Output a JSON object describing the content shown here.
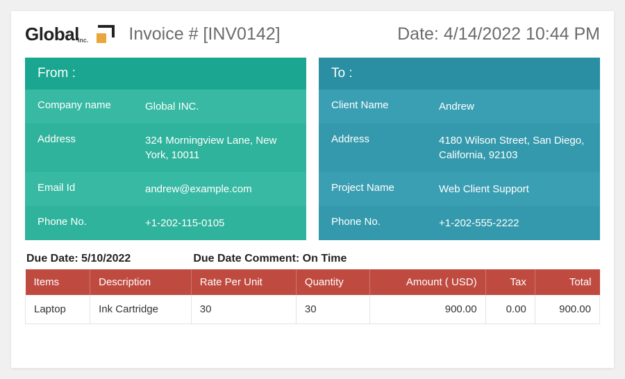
{
  "header": {
    "logo_main": "Global",
    "logo_sub": "Inc.",
    "invoice_number_label": "Invoice # [INV0142]",
    "date_label": "Date: 4/14/2022 10:44 PM"
  },
  "from": {
    "title": "From :",
    "fields": {
      "company_label": "Company name",
      "company_value": "Global INC.",
      "address_label": "Address",
      "address_value": "324 Morningview Lane, New York, 10011",
      "email_label": "Email Id",
      "email_value": "andrew@example.com",
      "phone_label": "Phone No.",
      "phone_value": "+1-202-115-0105"
    }
  },
  "to": {
    "title": "To :",
    "fields": {
      "client_label": "Client Name",
      "client_value": "Andrew",
      "address_label": "Address",
      "address_value": "4180 Wilson Street, San Diego, California, 92103",
      "project_label": "Project Name",
      "project_value": "Web Client Support",
      "phone_label": "Phone No.",
      "phone_value": "+1-202-555-2222"
    }
  },
  "due": {
    "date_label": "Due Date: ",
    "date_value": "5/10/2022",
    "comment_label": "Due Date Comment: ",
    "comment_value": "On Time"
  },
  "items_table": {
    "headers": {
      "items": "Items",
      "description": "Description",
      "rate": "Rate Per Unit",
      "quantity": "Quantity",
      "amount": "Amount ( USD)",
      "tax": "Tax",
      "total": "Total"
    },
    "rows": [
      {
        "items": "Laptop",
        "description": "Ink Cartridge",
        "rate": "30",
        "quantity": "30",
        "amount": "900.00",
        "tax": "0.00",
        "total": "900.00"
      }
    ]
  }
}
